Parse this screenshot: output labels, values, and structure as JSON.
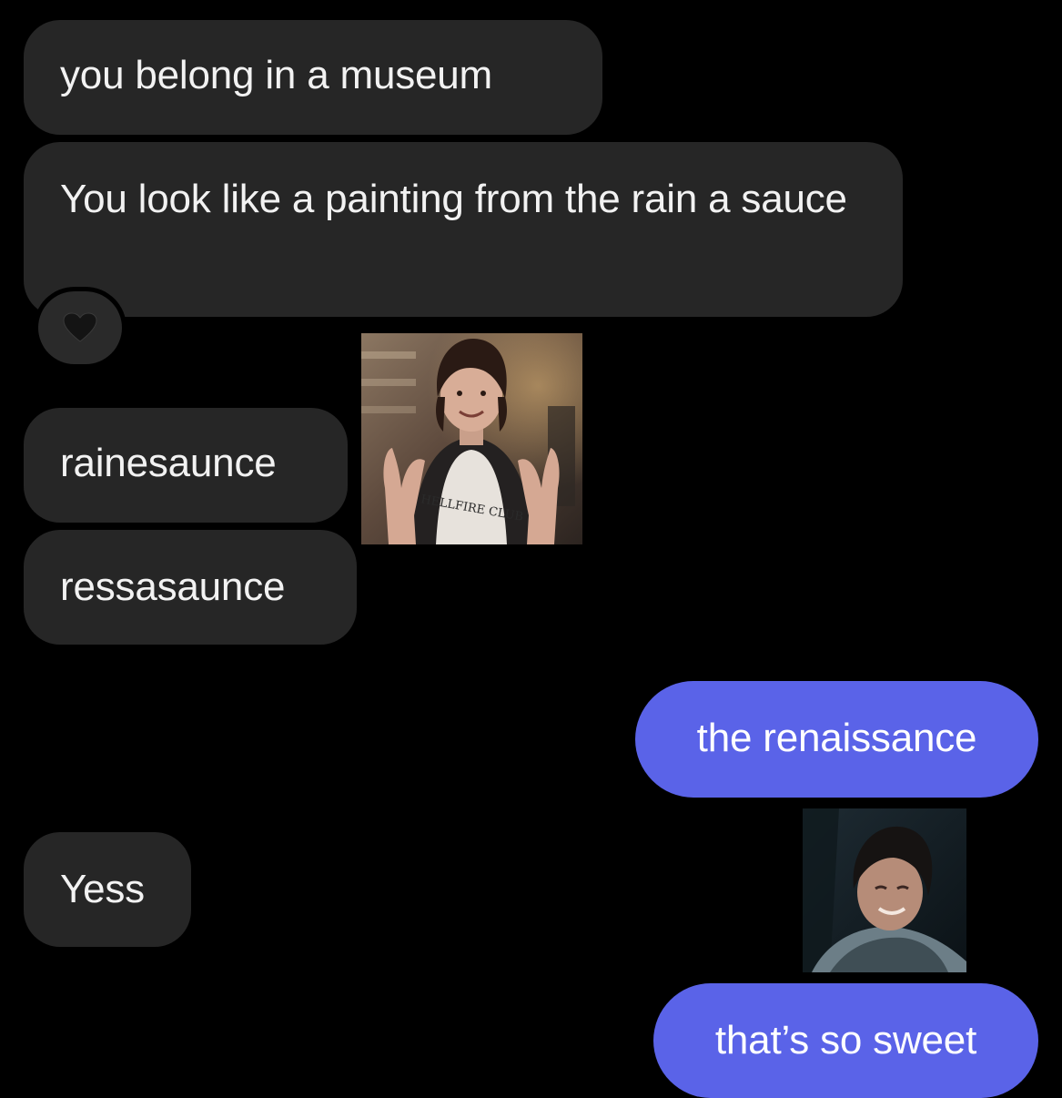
{
  "messages": [
    {
      "direction": "incoming",
      "text": "you belong in a museum"
    },
    {
      "direction": "incoming",
      "text": "You look like a painting from the rain a sauce",
      "reaction": "black-heart"
    },
    {
      "direction": "incoming",
      "text": "rainesaunce"
    },
    {
      "direction": "incoming",
      "text": "ressasaunce"
    },
    {
      "direction": "outgoing",
      "text": "the renaissance"
    },
    {
      "direction": "incoming",
      "text": "Yess"
    },
    {
      "direction": "outgoing",
      "text": "that’s so sweet"
    }
  ],
  "stickers": [
    {
      "icon": "photo-sticker",
      "shirt_text": "HELLFIRE CLUB"
    },
    {
      "icon": "photo-sticker"
    }
  ],
  "colors": {
    "background": "#000000",
    "incoming_bubble": "#262626",
    "outgoing_bubble": "#5a63e8",
    "text": "#f2f2f2"
  }
}
